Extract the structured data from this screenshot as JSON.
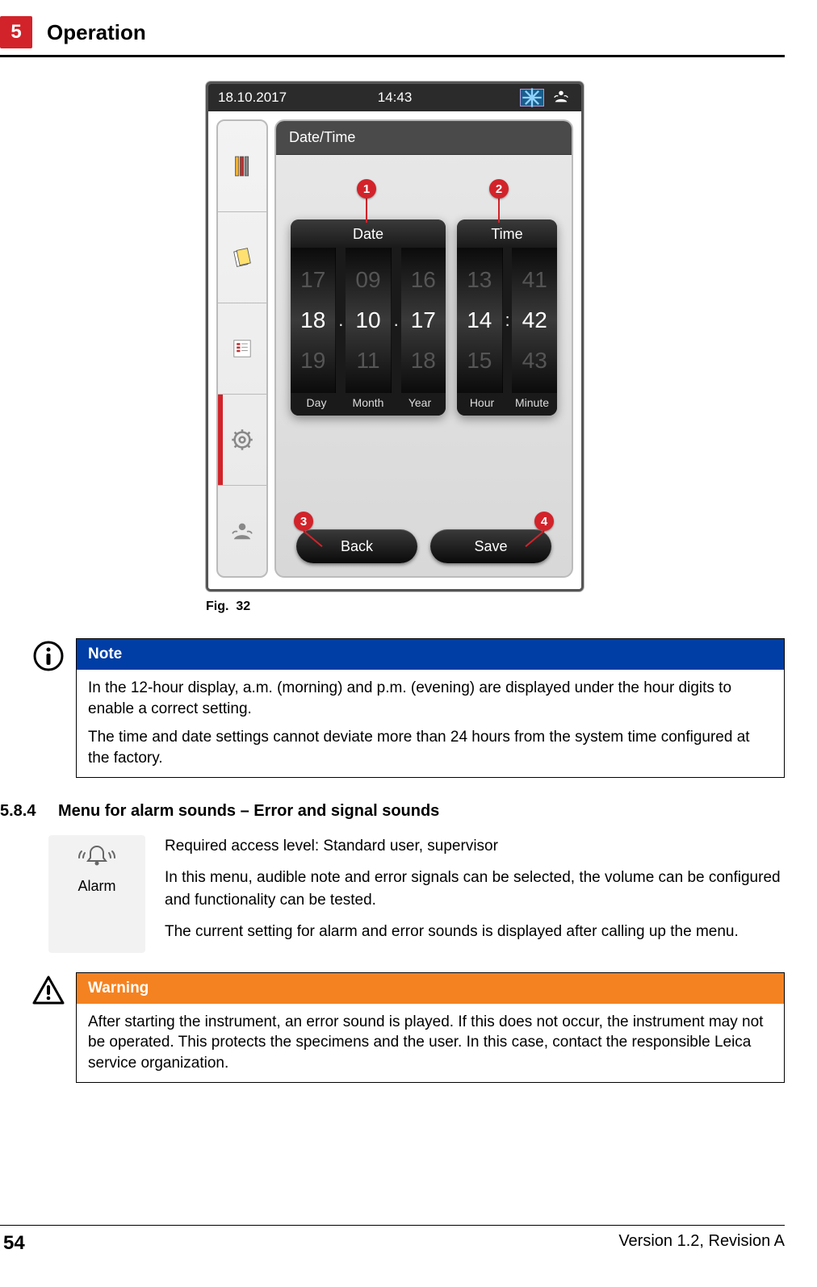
{
  "chapter": {
    "number": "5",
    "title": "Operation"
  },
  "device": {
    "status": {
      "date": "18.10.2017",
      "time": "14:43"
    },
    "panel_title": "Date/Time",
    "date_picker": {
      "header": "Date",
      "day": {
        "prev": "17",
        "cur": "18",
        "next": "19",
        "label": "Day"
      },
      "month": {
        "prev": "09",
        "cur": "10",
        "next": "11",
        "label": "Month"
      },
      "year": {
        "prev": "16",
        "cur": "17",
        "next": "18",
        "label": "Year"
      }
    },
    "time_picker": {
      "header": "Time",
      "hour": {
        "prev": "13",
        "cur": "14",
        "next": "15",
        "label": "Hour"
      },
      "minute": {
        "prev": "41",
        "cur": "42",
        "next": "43",
        "label": "Minute"
      }
    },
    "buttons": {
      "back": "Back",
      "save": "Save"
    },
    "callouts": {
      "c1": "1",
      "c2": "2",
      "c3": "3",
      "c4": "4"
    }
  },
  "fig_caption": "Fig.  32",
  "note": {
    "header": "Note",
    "p1": "In the 12-hour display, a.m. (morning) and p.m. (evening) are displayed under the hour digits to enable a correct setting.",
    "p2": "The time and date settings cannot deviate more than 24 hours from the system time configured at the factory."
  },
  "section": {
    "number": "5.8.4",
    "title": "Menu for alarm sounds – Error and signal sounds"
  },
  "alarm": {
    "label": "Alarm",
    "p1": "Required access level: Standard user, supervisor",
    "p2": "In this menu, audible note and error signals can be selected, the volume can be configured and functionality can be tested.",
    "p3": "The current setting for alarm and error sounds is displayed after calling up the menu."
  },
  "warning": {
    "header": "Warning",
    "body": "After starting the instrument, an error sound is played. If this does not occur, the instrument may not be operated. This protects the specimens and the user. In this case, contact the responsible Leica service organization."
  },
  "footer": {
    "page": "54",
    "version": "Version 1.2, Revision A"
  }
}
